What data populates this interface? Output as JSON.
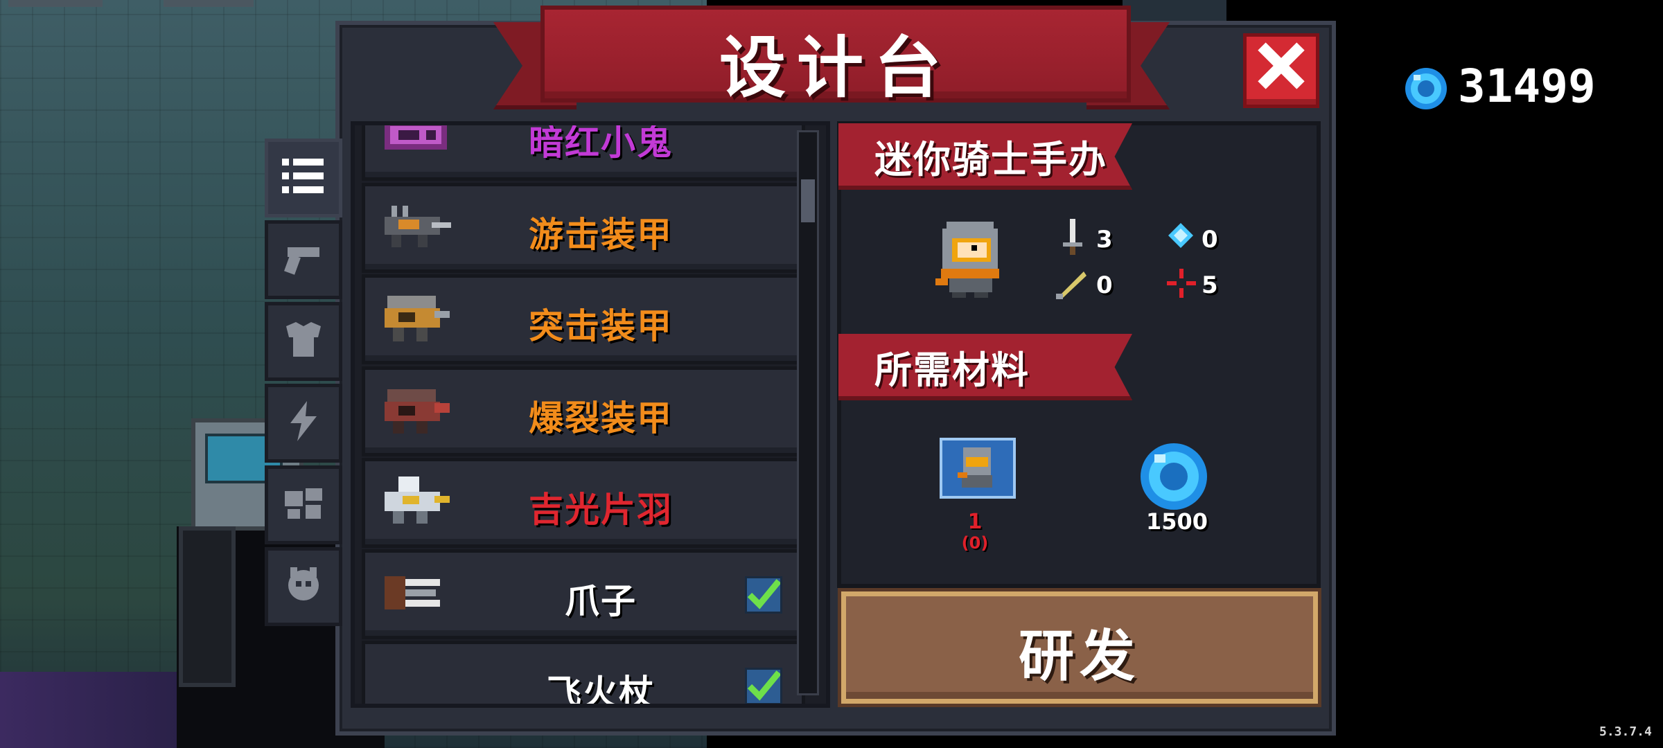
{
  "title": "设计台",
  "currency": {
    "icon": "gem-icon",
    "value": "31499"
  },
  "version": "5.3.7.4",
  "tabs": [
    {
      "icon": "list-icon",
      "active": true
    },
    {
      "icon": "gun-icon",
      "active": false
    },
    {
      "icon": "armor-icon",
      "active": false
    },
    {
      "icon": "lightning-icon",
      "active": false
    },
    {
      "icon": "parts-icon",
      "active": false
    },
    {
      "icon": "pet-icon",
      "active": false
    }
  ],
  "items": [
    {
      "label": "暗红小鬼",
      "color": "#c23ad6",
      "icon": "mech-icon",
      "checked": false
    },
    {
      "label": "游击装甲",
      "color": "#f28c1b",
      "icon": "mech-icon",
      "checked": false
    },
    {
      "label": "突击装甲",
      "color": "#f28c1b",
      "icon": "mech-icon",
      "checked": false
    },
    {
      "label": "爆裂装甲",
      "color": "#f28c1b",
      "icon": "mech-icon",
      "checked": false
    },
    {
      "label": "吉光片羽",
      "color": "#e0262f",
      "icon": "mech-icon",
      "checked": false
    },
    {
      "label": "爪子",
      "color": "#ffffff",
      "icon": "claw-icon",
      "checked": true
    },
    {
      "label": "飞火杖",
      "color": "#ffffff",
      "icon": "staff-icon",
      "checked": true
    }
  ],
  "detail": {
    "item_name": "迷你骑士手办",
    "stats": {
      "attack": "3",
      "energy": "0",
      "crit": "0",
      "accuracy": "5"
    },
    "materials_title": "所需材料",
    "material_blueprint": {
      "icon": "blueprint-icon",
      "count": "1",
      "owned": "(0)"
    },
    "material_gems": {
      "icon": "gem-icon",
      "cost": "1500"
    },
    "research_label": "研发"
  }
}
